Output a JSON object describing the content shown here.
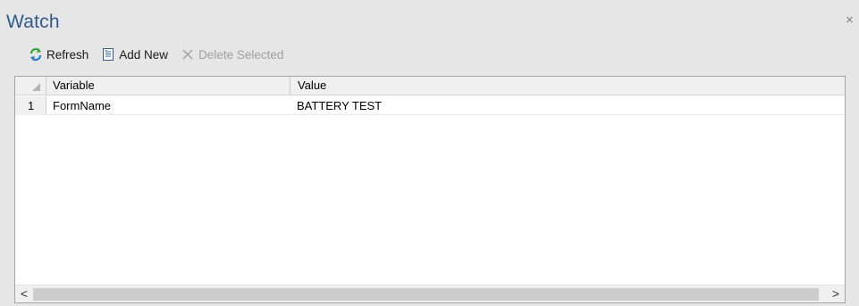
{
  "panel": {
    "title": "Watch",
    "close_glyph": "×"
  },
  "toolbar": {
    "refresh_label": "Refresh",
    "add_new_label": "Add New",
    "delete_selected_label": "Delete Selected"
  },
  "grid": {
    "columns": [
      "Variable",
      "Value"
    ],
    "rows": [
      {
        "num": "1",
        "variable": "FormName",
        "value": "BATTERY TEST"
      }
    ]
  },
  "scrollbar": {
    "left_glyph": "<",
    "right_glyph": ">"
  }
}
